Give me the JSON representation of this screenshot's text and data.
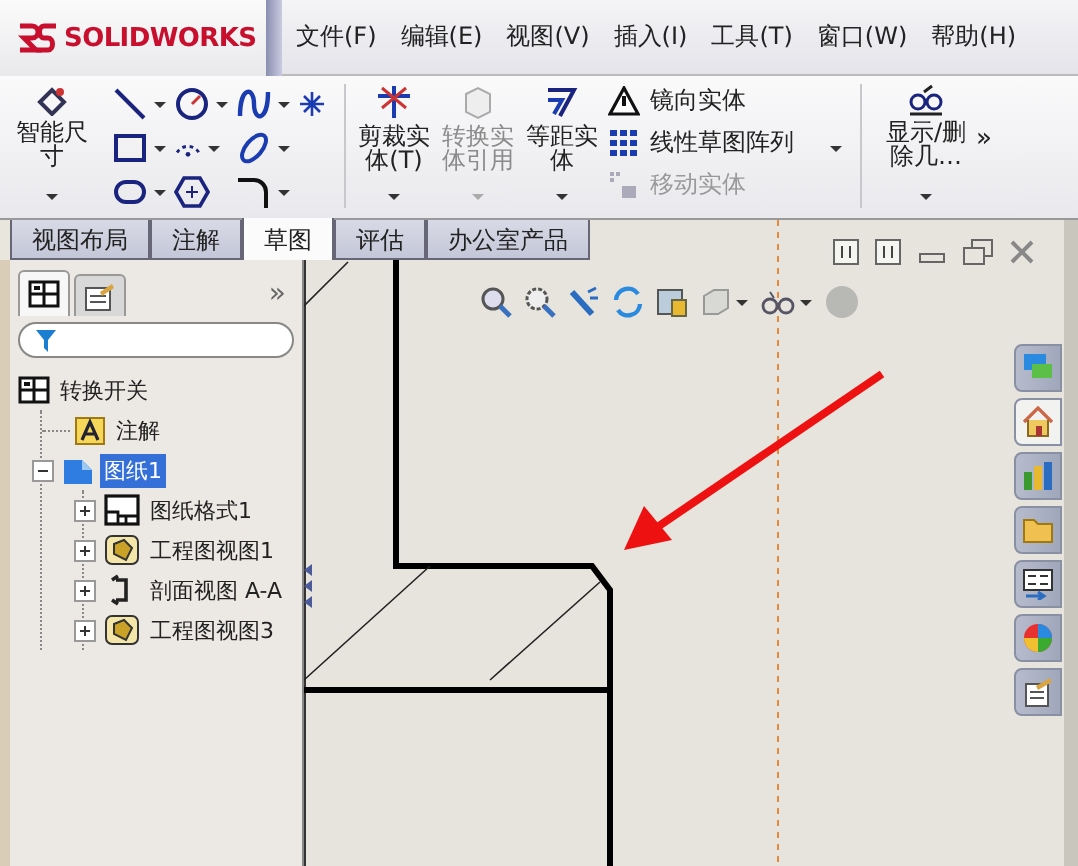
{
  "app": {
    "logo_text": "SOLIDWORKS"
  },
  "menu": [
    "文件(F)",
    "编辑(E)",
    "视图(V)",
    "插入(I)",
    "工具(T)",
    "窗口(W)",
    "帮助(H)"
  ],
  "ribbon": {
    "smart_dimension": {
      "label": "智能尺寸"
    },
    "commands": [
      {
        "label": "剪裁实体(T)",
        "kind": "trim",
        "disabled": false
      },
      {
        "label": "转换实体引用",
        "kind": "convert",
        "disabled": true
      },
      {
        "label": "等距实体",
        "kind": "offset",
        "disabled": false
      }
    ],
    "list_commands": [
      {
        "label": "镜向实体",
        "kind": "mirror",
        "disabled": false
      },
      {
        "label": "线性草图阵列",
        "kind": "pattern",
        "disabled": false
      },
      {
        "label": "移动实体",
        "kind": "move",
        "disabled": true
      }
    ],
    "display_delete": {
      "label": "显示/删除几…"
    },
    "overflow": "»"
  },
  "tabs": [
    {
      "label": "视图布局",
      "selected": false
    },
    {
      "label": "注解",
      "selected": false
    },
    {
      "label": "草图",
      "selected": true
    },
    {
      "label": "评估",
      "selected": false
    },
    {
      "label": "办公室产品",
      "selected": false
    }
  ],
  "feature_manager": {
    "tabs": [
      {
        "kind": "tree",
        "selected": true
      },
      {
        "kind": "properties",
        "selected": false
      }
    ],
    "expand": "»",
    "tree": {
      "label": "转换开关",
      "kind": "drawing",
      "selected": false,
      "children": [
        {
          "label": "注解",
          "kind": "annotation",
          "selected": false
        },
        {
          "label": "图纸1",
          "kind": "sheet",
          "selected": true,
          "expanded": true,
          "children": [
            {
              "label": "图纸格式1",
              "kind": "sheet-format",
              "selected": false,
              "expanded": false
            },
            {
              "label": "工程图视图1",
              "kind": "drawing-view",
              "selected": false,
              "expanded": false
            },
            {
              "label": "剖面视图 A-A",
              "kind": "section-view",
              "selected": false,
              "expanded": false
            },
            {
              "label": "工程图视图3",
              "kind": "drawing-view",
              "selected": false,
              "expanded": false
            }
          ]
        }
      ]
    }
  },
  "task_pane": [
    {
      "kind": "chat",
      "selected": false
    },
    {
      "kind": "home",
      "selected": true
    },
    {
      "kind": "library",
      "selected": false
    },
    {
      "kind": "folder",
      "selected": false
    },
    {
      "kind": "palette",
      "selected": false
    },
    {
      "kind": "appearance",
      "selected": false
    },
    {
      "kind": "properties",
      "selected": false
    }
  ]
}
